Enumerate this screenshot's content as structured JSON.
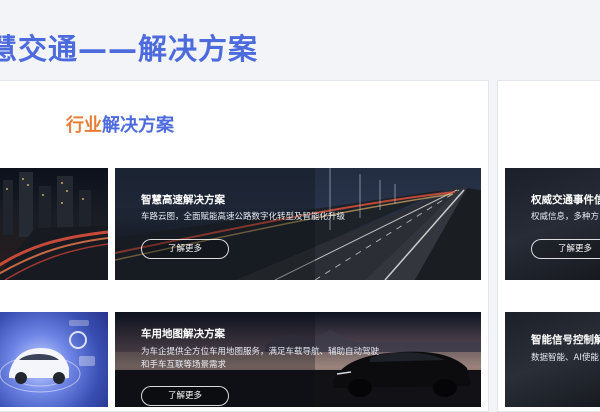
{
  "header": {
    "page_title": "慧交通——解决方案"
  },
  "section": {
    "heading_accent": "行业",
    "heading_rest": "解决方案"
  },
  "cards": {
    "highway": {
      "title": "智慧高速解决方案",
      "desc": "车路云图，全面赋能高速公路数字化转型及智能化升级",
      "button": "了解更多"
    },
    "map": {
      "title": "车用地图解决方案",
      "desc_line1": "为车企提供全方位车用地图服务，满足车载导航、辅助自动驾驶",
      "desc_line2": "和手车互联等场景需求",
      "button": "了解更多"
    },
    "traffic_event": {
      "title": "权威交通事件信",
      "desc": "权威信息，多种方",
      "button": "了解更多"
    },
    "signal": {
      "title": "智能信号控制解",
      "desc": "数据智能、AI使能"
    }
  },
  "colors": {
    "title_blue": "#4d6bdc",
    "accent_orange": "#e67e3a",
    "page_bg": "#f2f4f8"
  }
}
